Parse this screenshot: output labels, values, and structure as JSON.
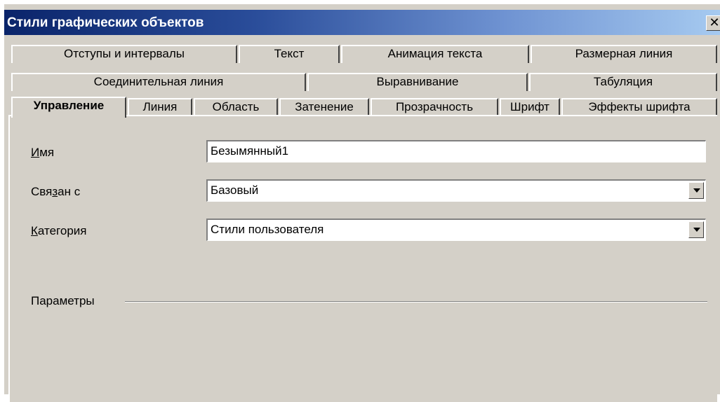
{
  "window": {
    "title": "Стили графических объектов",
    "close_glyph": "✕"
  },
  "tabs": {
    "row1": [
      "Отступы и интервалы",
      "Текст",
      "Анимация текста",
      "Размерная линия"
    ],
    "row2": [
      "Соединительная линия",
      "Выравнивание",
      "Табуляция"
    ],
    "row3": [
      "Управление",
      "Линия",
      "Область",
      "Затенение",
      "Прозрачность",
      "Шрифт",
      "Эффекты шрифта"
    ],
    "active": "Управление"
  },
  "form": {
    "name": {
      "label_u": "И",
      "label_rest": "мя",
      "value": "Безымянный1"
    },
    "linked": {
      "label_pre": "Свя",
      "label_u": "з",
      "label_rest": "ан с",
      "value": "Базовый"
    },
    "category": {
      "label_u": "К",
      "label_rest": "атегория",
      "value": "Стили пользователя"
    }
  },
  "parameters": {
    "label": "Параметры"
  },
  "icons": {
    "close": "close-icon",
    "dropdown": "chevron-down-icon"
  }
}
